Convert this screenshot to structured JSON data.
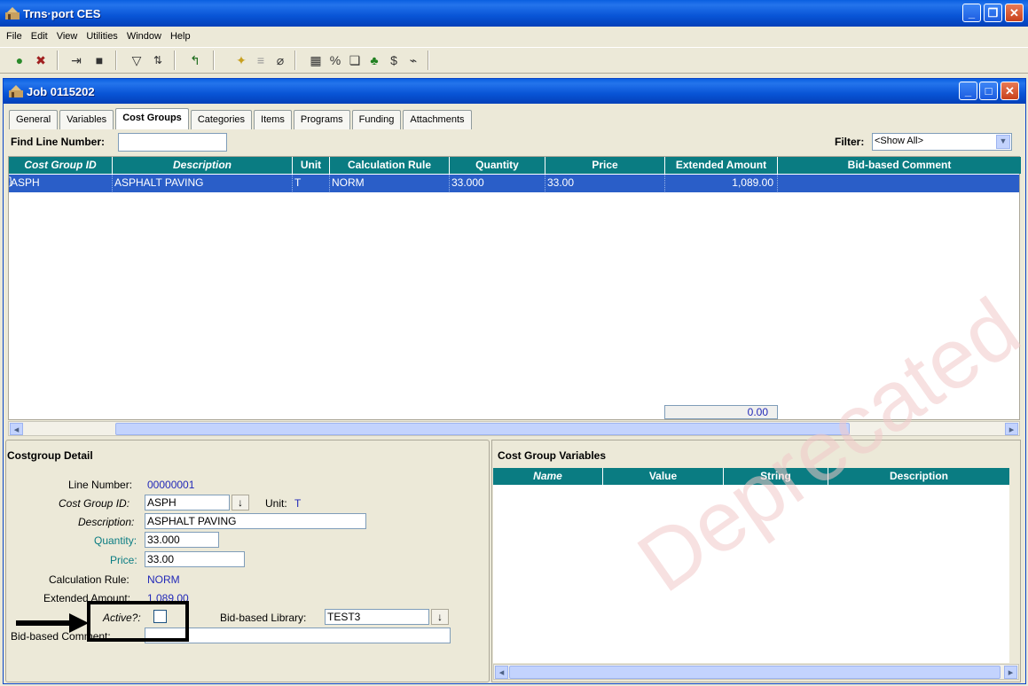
{
  "app": {
    "title": "Trns·port CES",
    "menu": [
      "File",
      "Edit",
      "View",
      "Utilities",
      "Window",
      "Help"
    ]
  },
  "job": {
    "title": "Job 0115202",
    "tabs": [
      "General",
      "Variables",
      "Cost Groups",
      "Categories",
      "Items",
      "Programs",
      "Funding",
      "Attachments"
    ],
    "active_tab": "Cost Groups",
    "find_label": "Find Line Number:",
    "find_value": "",
    "filter_label": "Filter:",
    "filter_value": "<Show All>"
  },
  "grid": {
    "columns": [
      "Cost Group ID",
      "Description",
      "Unit",
      "Calculation Rule",
      "Quantity",
      "Price",
      "Extended Amount",
      "Bid-based Comment"
    ],
    "rows": [
      {
        "id": "ASPH",
        "description": "ASPHALT PAVING",
        "unit": "T",
        "rule": "NORM",
        "quantity": "33.000",
        "price": "33.00",
        "extended": "1,089.00",
        "comment": ""
      }
    ],
    "total": "0.00"
  },
  "detail": {
    "title": "Costgroup Detail",
    "line_number_label": "Line Number:",
    "line_number": "00000001",
    "cost_group_id_label": "Cost Group ID:",
    "cost_group_id": "ASPH",
    "unit_label": "Unit:",
    "unit": "T",
    "description_label": "Description:",
    "description": "ASPHALT PAVING",
    "quantity_label": "Quantity:",
    "quantity": "33.000",
    "price_label": "Price:",
    "price": "33.00",
    "calc_rule_label": "Calculation Rule:",
    "calc_rule": "NORM",
    "extended_label": "Extended Amount:",
    "extended": "1,089.00",
    "active_label": "Active?:",
    "active_checked": false,
    "library_label": "Bid-based Library:",
    "library": "TEST3",
    "comment_label": "Bid-based Comment:",
    "comment": ""
  },
  "variables": {
    "title": "Cost Group Variables",
    "columns": [
      "Name",
      "Value",
      "String",
      "Description"
    ]
  },
  "watermark": "Deprecated"
}
